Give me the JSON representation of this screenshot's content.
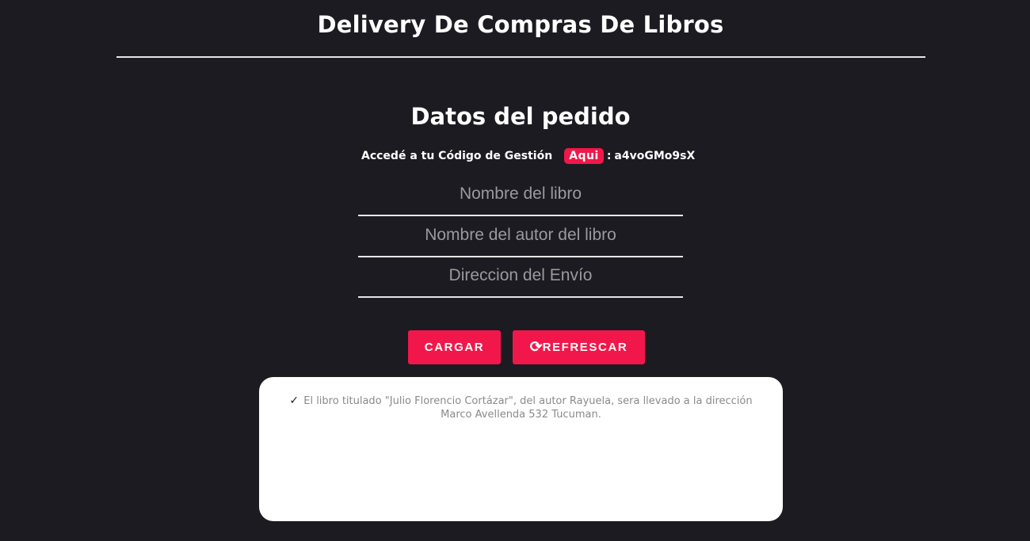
{
  "header": {
    "title": "Delivery De Compras De Libros"
  },
  "form": {
    "title": "Datos del pedido",
    "code_intro": "Accedé a tu Código de Gestión",
    "code_link_label": "Aqui",
    "code_separator": ":",
    "code_value": "a4voGMo9sX",
    "fields": {
      "book_name_placeholder": "Nombre del libro",
      "author_name_placeholder": "Nombre del autor del libro",
      "address_placeholder": "Direccion del Envío"
    },
    "buttons": {
      "load_label": "CARGAR",
      "refresh_icon": "refresh-icon",
      "refresh_label": "REFRESCAR"
    }
  },
  "result": {
    "icon": "check-icon",
    "message": "El libro titulado \"Julio Florencio Cortázar\", del autor Rayuela, sera llevado a la dirección Marco Avellenda 532 Tucuman."
  },
  "colors": {
    "background": "#1c1b21",
    "accent": "#f2174a",
    "text": "#ffffff",
    "result_box": "#ffffff"
  }
}
